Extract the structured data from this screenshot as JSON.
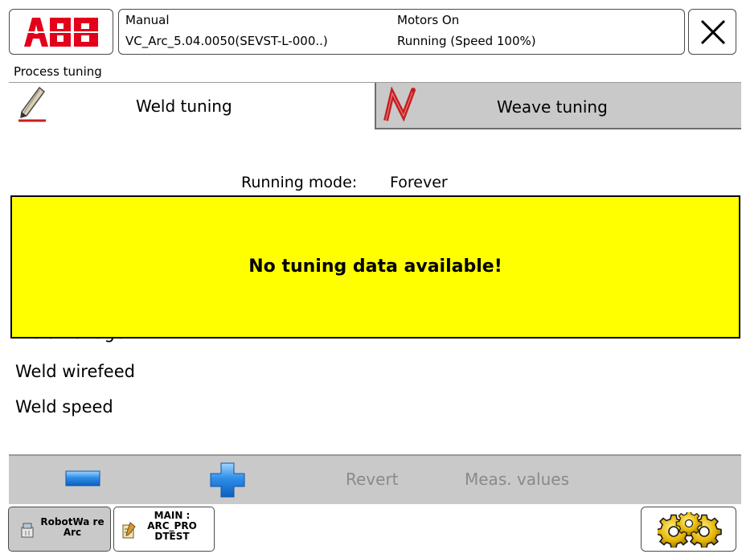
{
  "header": {
    "logo_text": "ABB",
    "mode": "Manual",
    "controller": "VC_Arc_5.04.0050(SEVST-L-000..)",
    "motors": "Motors On",
    "running": "Running (Speed 100%)"
  },
  "page_title": "Process tuning",
  "tabs": [
    {
      "label": "Weld tuning",
      "icon": "pencil-icon",
      "active": true
    },
    {
      "label": "Weave tuning",
      "icon": "weave-icon",
      "active": false
    }
  ],
  "running_mode": {
    "label": "Running mode:",
    "value": "Forever"
  },
  "parameters": [
    "Weld voltage",
    "Weld wirefeed",
    "Weld speed"
  ],
  "overlay": {
    "message": "No tuning data available!",
    "color": "#ffff00"
  },
  "commands": {
    "decrease_icon": "minus-icon",
    "increase_icon": "plus-icon",
    "revert": "Revert",
    "meas_values": "Meas. values"
  },
  "taskbar": {
    "items": [
      {
        "label": "RobotWa re Arc",
        "icon": "robotware-icon",
        "active": true
      },
      {
        "label": "MAIN : ARC_PRO DTEST",
        "icon": "program-icon",
        "active": false
      }
    ],
    "quickset_icon": "gears-icon"
  },
  "colors": {
    "accent_red": "#e3001b",
    "tab_inactive": "#c9c9c9",
    "command_bar": "#c9c9c9"
  }
}
